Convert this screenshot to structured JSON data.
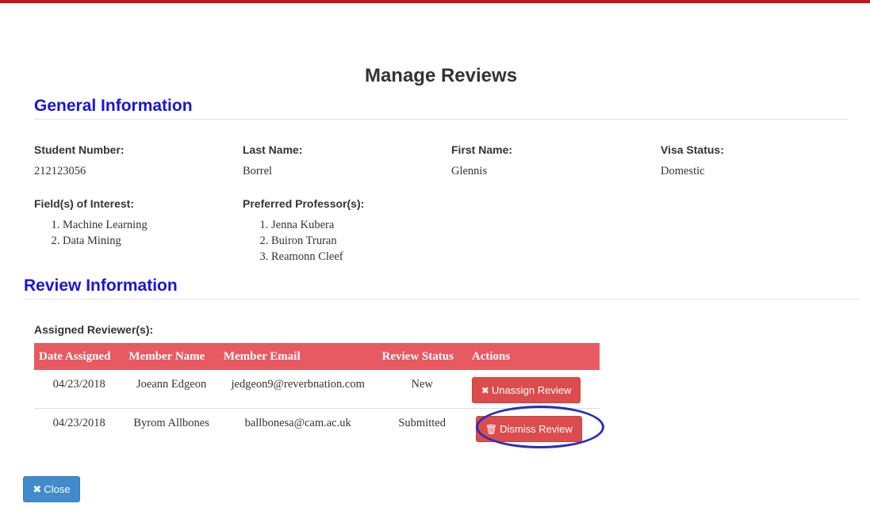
{
  "page_title": "Manage Reviews",
  "general": {
    "heading": "General Information",
    "student_number_label": "Student Number:",
    "student_number": "212123056",
    "last_name_label": "Last Name:",
    "last_name": "Borrel",
    "first_name_label": "First Name:",
    "first_name": "Glennis",
    "visa_label": "Visa Status:",
    "visa": "Domestic",
    "fields_label": "Field(s) of Interest:",
    "fields": [
      "Machine Learning",
      "Data Mining"
    ],
    "professors_label": "Preferred Professor(s):",
    "professors": [
      "Jenna Kubera",
      "Buiron Truran",
      "Reamonn Cleef"
    ]
  },
  "review": {
    "heading": "Review Information",
    "assigned_label": "Assigned Reviewer(s):",
    "columns": [
      "Date Assigned",
      "Member Name",
      "Member Email",
      "Review Status",
      "Actions"
    ],
    "rows": [
      {
        "date": "04/23/2018",
        "name": "Joeann Edgeon",
        "email": "jedgeon9@reverbnation.com",
        "status": "New",
        "action": "Unassign Review",
        "action_icon": "times-circle-icon"
      },
      {
        "date": "04/23/2018",
        "name": "Byrom Allbones",
        "email": "ballbonesa@cam.ac.uk",
        "status": "Submitted",
        "action": "Dismiss Review",
        "action_icon": "trash-icon"
      }
    ]
  },
  "close_label": "Close",
  "colors": {
    "accent_bar": "#c0161f",
    "heading_blue": "#1a14d8",
    "table_header": "#e85a62",
    "danger_button": "#dc4c4c",
    "primary_button": "#428bca",
    "highlight_circle": "#2a2fb8"
  }
}
